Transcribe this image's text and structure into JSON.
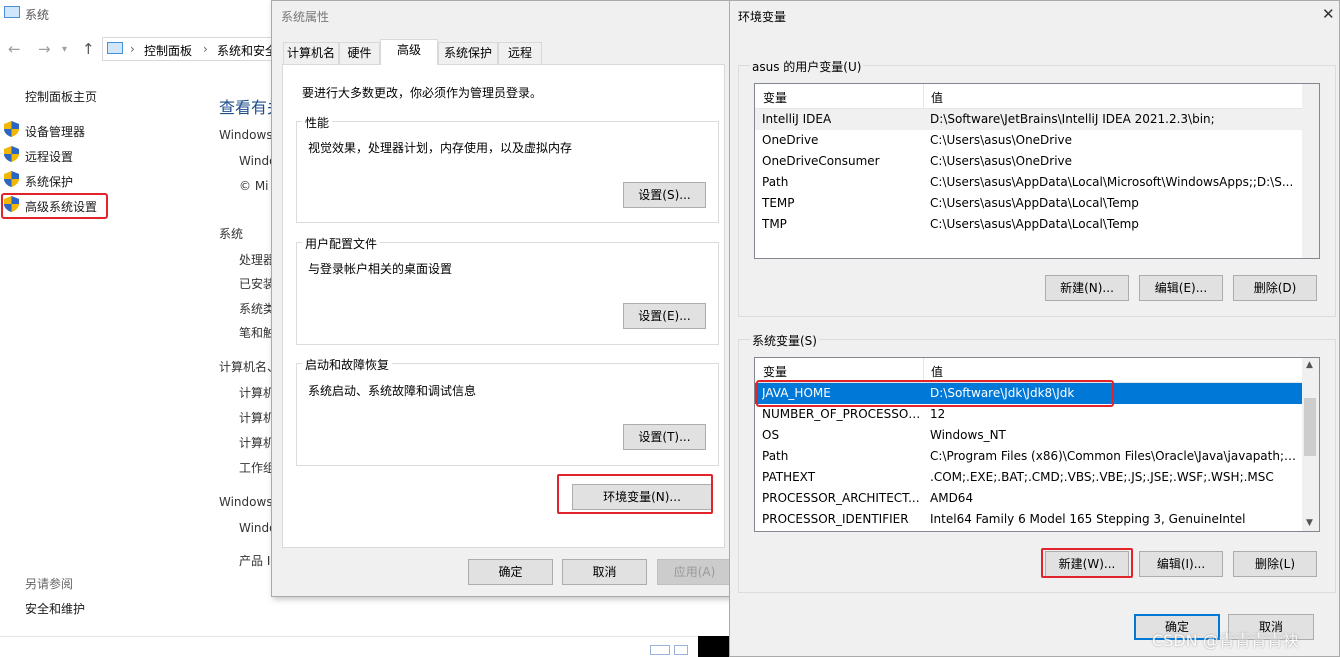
{
  "system_window": {
    "title": "系统",
    "breadcrumb": [
      "控制面板",
      "系统和安全"
    ],
    "side_home": "控制面板主页",
    "side_links": [
      "设备管理器",
      "远程设置",
      "系统保护",
      "高级系统设置"
    ],
    "heading": "查看有关",
    "sections": [
      {
        "label": "Windows",
        "rows": [
          "Windo",
          "© Mi"
        ]
      },
      {
        "label": "系统",
        "rows": [
          "处理器",
          "已安装",
          "系统类",
          "笔和触"
        ]
      },
      {
        "label": "计算机名、",
        "rows": [
          "计算机",
          "计算机",
          "计算机",
          "工作组"
        ]
      },
      {
        "label": "Windows",
        "rows": [
          "Windo",
          "产品 I"
        ]
      }
    ],
    "see_also": "另请参阅",
    "maintenance": "安全和维护"
  },
  "props_dialog": {
    "title": "系统属性",
    "tabs": [
      "计算机名",
      "硬件",
      "高级",
      "系统保护",
      "远程"
    ],
    "admin_note": "要进行大多数更改，你必须作为管理员登录。",
    "groups": [
      {
        "title": "性能",
        "desc": "视觉效果，处理器计划，内存使用，以及虚拟内存",
        "button": "设置(S)..."
      },
      {
        "title": "用户配置文件",
        "desc": "与登录帐户相关的桌面设置",
        "button": "设置(E)..."
      },
      {
        "title": "启动和故障恢复",
        "desc": "系统启动、系统故障和调试信息",
        "button": "设置(T)..."
      }
    ],
    "env_button": "环境变量(N)...",
    "ok": "确定",
    "cancel": "取消",
    "apply": "应用(A)"
  },
  "env_dialog": {
    "title": "环境变量",
    "close": "✕",
    "user_label": "asus 的用户变量(U)",
    "sys_label": "系统变量(S)",
    "col_var": "变量",
    "col_val": "值",
    "user_vars": [
      [
        "IntelliJ IDEA",
        "D:\\Software\\JetBrains\\IntelliJ IDEA 2021.2.3\\bin;"
      ],
      [
        "OneDrive",
        "C:\\Users\\asus\\OneDrive"
      ],
      [
        "OneDriveConsumer",
        "C:\\Users\\asus\\OneDrive"
      ],
      [
        "Path",
        "C:\\Users\\asus\\AppData\\Local\\Microsoft\\WindowsApps;;D:\\S..."
      ],
      [
        "TEMP",
        "C:\\Users\\asus\\AppData\\Local\\Temp"
      ],
      [
        "TMP",
        "C:\\Users\\asus\\AppData\\Local\\Temp"
      ]
    ],
    "sys_vars": [
      [
        "JAVA_HOME",
        "D:\\Software\\Jdk\\Jdk8\\Jdk"
      ],
      [
        "NUMBER_OF_PROCESSORS",
        "12"
      ],
      [
        "OS",
        "Windows_NT"
      ],
      [
        "Path",
        "C:\\Program Files (x86)\\Common Files\\Oracle\\Java\\javapath;C:..."
      ],
      [
        "PATHEXT",
        ".COM;.EXE;.BAT;.CMD;.VBS;.VBE;.JS;.JSE;.WSF;.WSH;.MSC"
      ],
      [
        "PROCESSOR_ARCHITECT...",
        "AMD64"
      ],
      [
        "PROCESSOR_IDENTIFIER",
        "Intel64 Family 6 Model 165 Stepping 3, GenuineIntel"
      ]
    ],
    "user_buttons": [
      "新建(N)...",
      "编辑(E)...",
      "删除(D)"
    ],
    "sys_buttons": [
      "新建(W)...",
      "编辑(I)...",
      "删除(L)"
    ],
    "ok": "确定",
    "cancel": "取消"
  },
  "watermark": "CSDN @青青青青袂",
  "colors": {
    "highlight": "#e0242a",
    "selection": "#0078d7",
    "link": "#1e4e8c"
  }
}
